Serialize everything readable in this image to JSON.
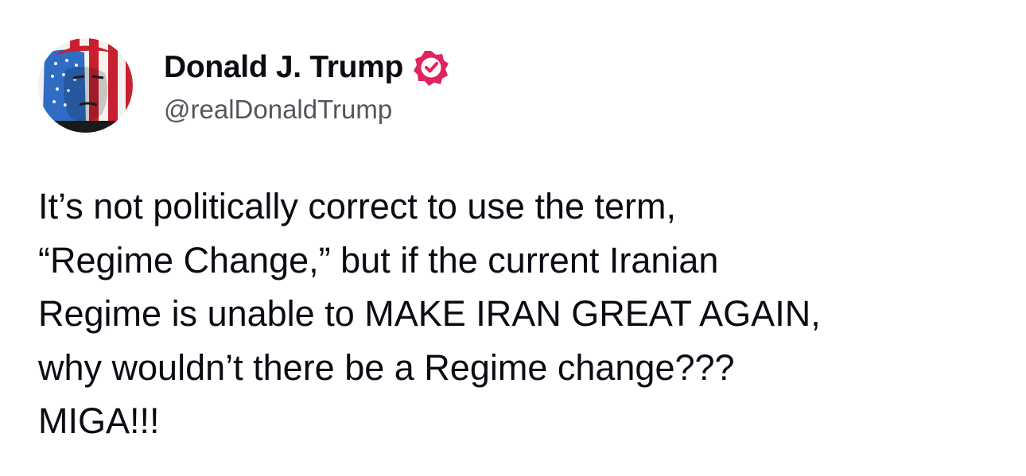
{
  "post": {
    "author": {
      "display_name": "Donald J. Trump",
      "handle": "@realDonaldTrump",
      "verified": true,
      "verified_icon": "verified-badge-icon",
      "verified_color": "#e0245e",
      "avatar": "profile-photo"
    },
    "body_lines": [
      "It’s not politically correct to use the term,",
      "“Regime Change,” but if the current Iranian",
      "Regime is unable to MAKE IRAN GREAT AGAIN,",
      "why wouldn’t there be a Regime change???",
      "MIGA!!!"
    ]
  },
  "colors": {
    "background": "#ffffff",
    "text": "#0b0b14",
    "handle": "#55555f"
  }
}
